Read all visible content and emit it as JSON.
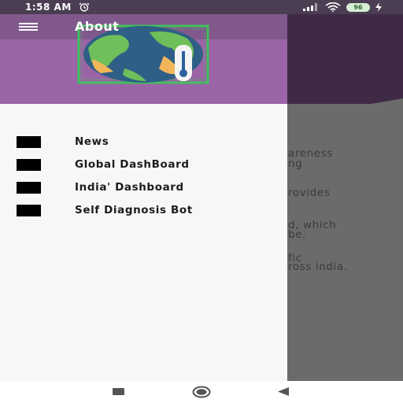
{
  "status_bar": {
    "time": "1:58 AM",
    "battery_level": "96",
    "icons": [
      "alarm-icon",
      "signal-icon",
      "wifi-icon",
      "battery-icon",
      "charging-bolt-icon"
    ]
  },
  "drawer": {
    "title": "About",
    "menu_items": [
      {
        "label": "News",
        "icon": "news-icon"
      },
      {
        "label": "Global DashBoard",
        "icon": "global-dashboard-icon"
      },
      {
        "label": "India' Dashboard",
        "icon": "india-dashboard-icon"
      },
      {
        "label": "Self Diagnosis Bot",
        "icon": "self-diagnosis-bot-icon"
      }
    ]
  },
  "background_content": {
    "lines": [
      "areness",
      "ng",
      "rovides",
      "d, which",
      "be.",
      "fic",
      "ross india."
    ]
  },
  "colors": {
    "header_purple": "#9b64a7",
    "toolbar_purple": "#80588c",
    "scrim_dark": "#3f2a45",
    "drawer_bg": "#f7f7f7",
    "logo_green": "#3fc15a"
  }
}
